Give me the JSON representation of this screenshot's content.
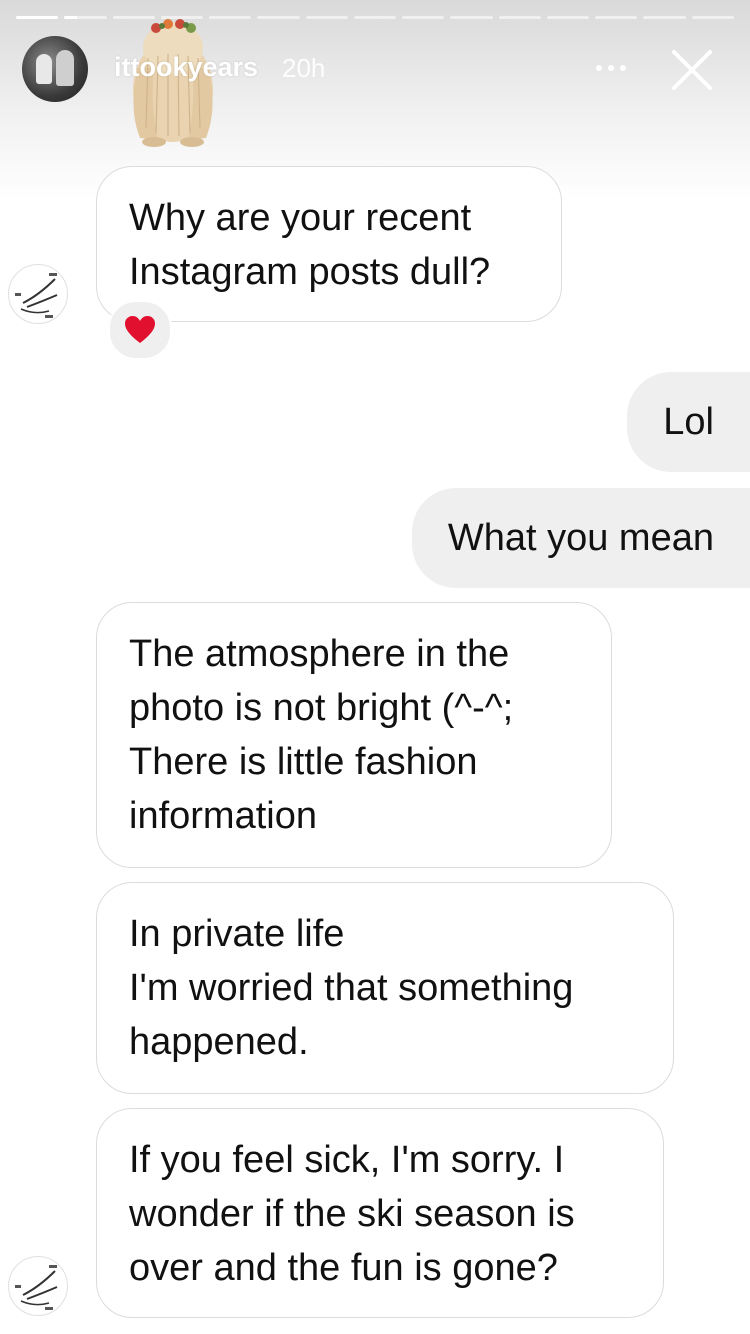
{
  "story": {
    "segments_total": 15,
    "segments_completed": 1,
    "current_segment_progress": 0.3
  },
  "header": {
    "username": "ittookyears",
    "timestamp": "20h",
    "more_icon": "more-horizontal-icon",
    "close_icon": "close-icon"
  },
  "sticker": {
    "icon": "dog-sticker"
  },
  "messages": [
    {
      "from": "them",
      "text": "Why are your recent\nInstagram posts dull?",
      "reaction": "❤️"
    },
    {
      "from": "me",
      "text": "Lol"
    },
    {
      "from": "me",
      "text": "What you mean"
    },
    {
      "from": "them",
      "text": "The atmosphere in the\nphoto is not bright (^-^;\nThere is little fashion\ninformation"
    },
    {
      "from": "them",
      "text": "In private life\nI'm worried that something\nhappened."
    },
    {
      "from": "them",
      "text": "If you feel sick, I'm sorry. I\nwonder if the ski season is\nover and the fun is gone?"
    }
  ],
  "colors": {
    "incoming_bubble_bg": "#ffffff",
    "incoming_bubble_border": "#dcdcdc",
    "outgoing_bubble_bg": "#efefef",
    "text": "#111111",
    "reaction_heart": "#e0102e"
  }
}
